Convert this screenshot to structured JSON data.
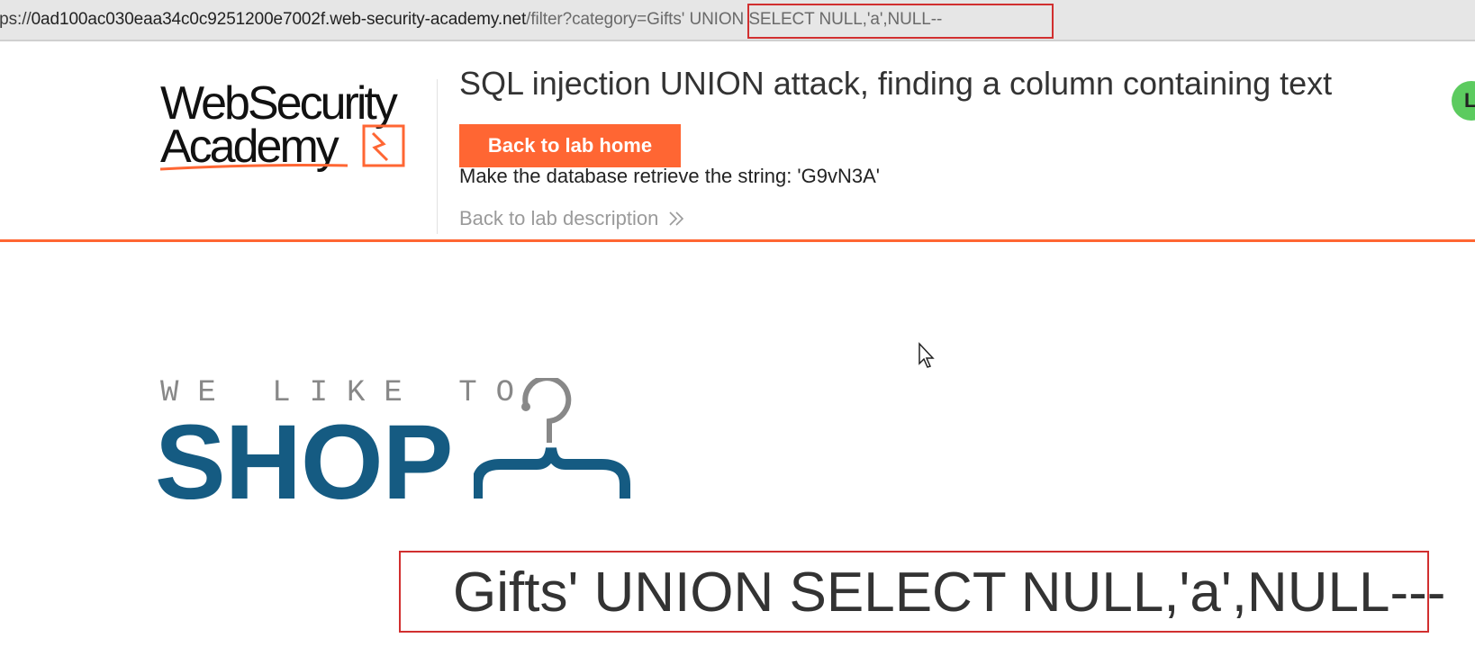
{
  "browser": {
    "url_scheme_fragment": "tps://",
    "url_host": "0ad100ac030eaa34c0c9251200e7002f.web-security-academy.net",
    "url_path": "/filter?category=Gifts' UNION SELECT NULL,'a',NULL--"
  },
  "header": {
    "logo_line1": "WebSecurity",
    "logo_line2": "Academy",
    "lab_title": "SQL injection UNION attack, finding a column containing text",
    "back_home_label": "Back to lab home",
    "instruction": "Make the database retrieve the string: 'G9vN3A'",
    "back_description_label": "Back to lab description",
    "back_description_icon": "double-chevron-right-icon",
    "avatar_letter": "L"
  },
  "shop": {
    "tagline": "WE LIKE TO",
    "brand_word": "SHOP",
    "icon": "hanger-icon"
  },
  "result": {
    "heading": "Gifts' UNION SELECT NULL,'a',NULL---"
  },
  "colors": {
    "accent": "#ff6633",
    "brand_blue": "#155b82",
    "highlight_red": "#d12f2f",
    "avatar_green": "#5ccb5f"
  }
}
